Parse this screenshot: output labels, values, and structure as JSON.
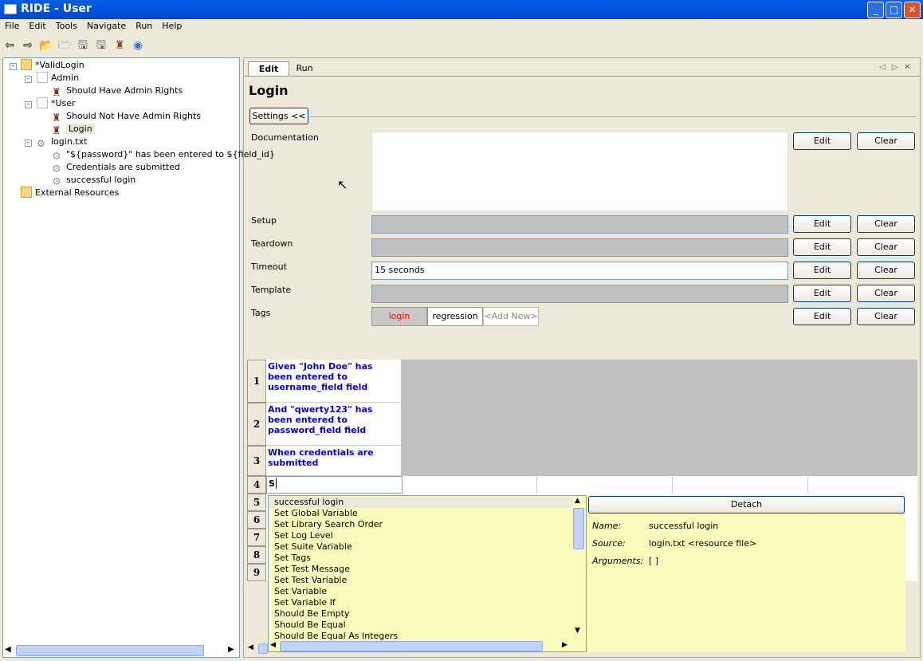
{
  "window": {
    "title": "RIDE - User",
    "buttons": [
      "_",
      "□",
      "✕"
    ]
  },
  "menu": [
    "File",
    "Edit",
    "Tools",
    "Navigate",
    "Run",
    "Help"
  ],
  "toolbar": [
    "back-icon",
    "forward-icon",
    "open-suite-icon",
    "open-dir-icon",
    "save-icon",
    "save-all-icon",
    "robot-icon",
    "stop-icon"
  ],
  "tree": {
    "root": "*ValidLogin",
    "items": [
      {
        "label": "Admin",
        "type": "file"
      },
      {
        "label": "Should Have Admin Rights",
        "type": "test"
      },
      {
        "label": "*User",
        "type": "file"
      },
      {
        "label": "Should Not Have Admin Rights",
        "type": "test"
      },
      {
        "label": "Login",
        "type": "test",
        "selected": true
      },
      {
        "label": "login.txt",
        "type": "resource"
      },
      {
        "label": "\"${password}\" has been entered to ${field_id}",
        "type": "keyword"
      },
      {
        "label": "Credentials are submitted",
        "type": "keyword"
      },
      {
        "label": "successful login",
        "type": "keyword"
      },
      {
        "label": "External Resources",
        "type": "external"
      }
    ]
  },
  "tabs": [
    {
      "label": "Edit",
      "active": true
    },
    {
      "label": "Run"
    }
  ],
  "editor": {
    "title": "Login",
    "settings_button": "Settings <<",
    "rows": [
      {
        "label": "Documentation",
        "value": ""
      },
      {
        "label": "Setup",
        "value": ""
      },
      {
        "label": "Teardown",
        "value": ""
      },
      {
        "label": "Timeout",
        "value": "15 seconds"
      },
      {
        "label": "Template",
        "value": ""
      },
      {
        "label": "Tags",
        "value": ""
      }
    ],
    "edit_label": "Edit",
    "clear_label": "Clear",
    "tags": [
      "login",
      "regression",
      "<Add New>"
    ]
  },
  "grid": {
    "rows": [
      "1",
      "2",
      "3",
      "4",
      "5",
      "6",
      "7",
      "8",
      "9"
    ],
    "cells": [
      "Given \"John Doe\" has been entered to username_field field",
      "And \"qwerty123\" has been entered to password_field field",
      "When credentials are submitted",
      "S"
    ]
  },
  "autocomplete": {
    "items": [
      "successful login",
      "Set Global Variable",
      "Set Library Search Order",
      "Set Log Level",
      "Set Suite Variable",
      "Set Tags",
      "Set Test Message",
      "Set Test Variable",
      "Set Variable",
      "Set Variable If",
      "Should Be Empty",
      "Should Be Equal",
      "Should Be Equal As Integers"
    ],
    "selected": "successful login"
  },
  "details": {
    "detach": "Detach",
    "name_label": "Name:",
    "name": "successful login",
    "source_label": "Source:",
    "source": "login.txt <resource file>",
    "args_label": "Arguments:",
    "args": "[ ]"
  },
  "colors": {
    "keyword": "#0000ee",
    "popup_bg": "#fbfbbb",
    "tag_login": "#ff0000"
  }
}
